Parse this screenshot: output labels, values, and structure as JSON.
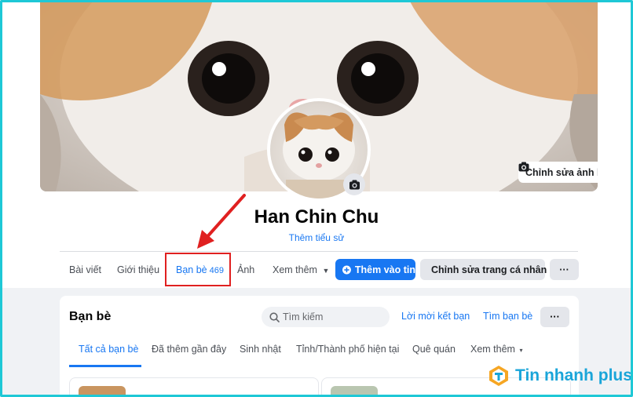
{
  "profile": {
    "edit_cover_label": "Chỉnh sửa ảnh bìa",
    "name": "Han Chin Chu",
    "add_bio_label": "Thêm tiểu sử"
  },
  "tabs": {
    "posts": "Bài viết",
    "about": "Giới thiệu",
    "friends": "Bạn bè",
    "friends_count": "469",
    "photos": "Ảnh",
    "more": "Xem thêm"
  },
  "actions": {
    "add_story": "Thêm vào tin",
    "edit_profile": "Chỉnh sửa trang cá nhân",
    "more": "···"
  },
  "friends_section": {
    "title": "Bạn bè",
    "search_placeholder": "Tìm kiếm",
    "friend_requests": "Lời mời kết bạn",
    "find_friends": "Tìm bạn bè",
    "more": "···",
    "filters": [
      "Tất cả bạn bè",
      "Đã thêm gần đây",
      "Sinh nhật",
      "Tỉnh/Thành phố hiện tại",
      "Quê quán",
      "Xem thêm"
    ]
  },
  "watermark": {
    "brand": "Tin nhanh plus"
  },
  "colors": {
    "accent": "#1877f2",
    "highlight": "#e02020",
    "frame": "#1ec8d6",
    "brand": "#1aa5d9"
  }
}
